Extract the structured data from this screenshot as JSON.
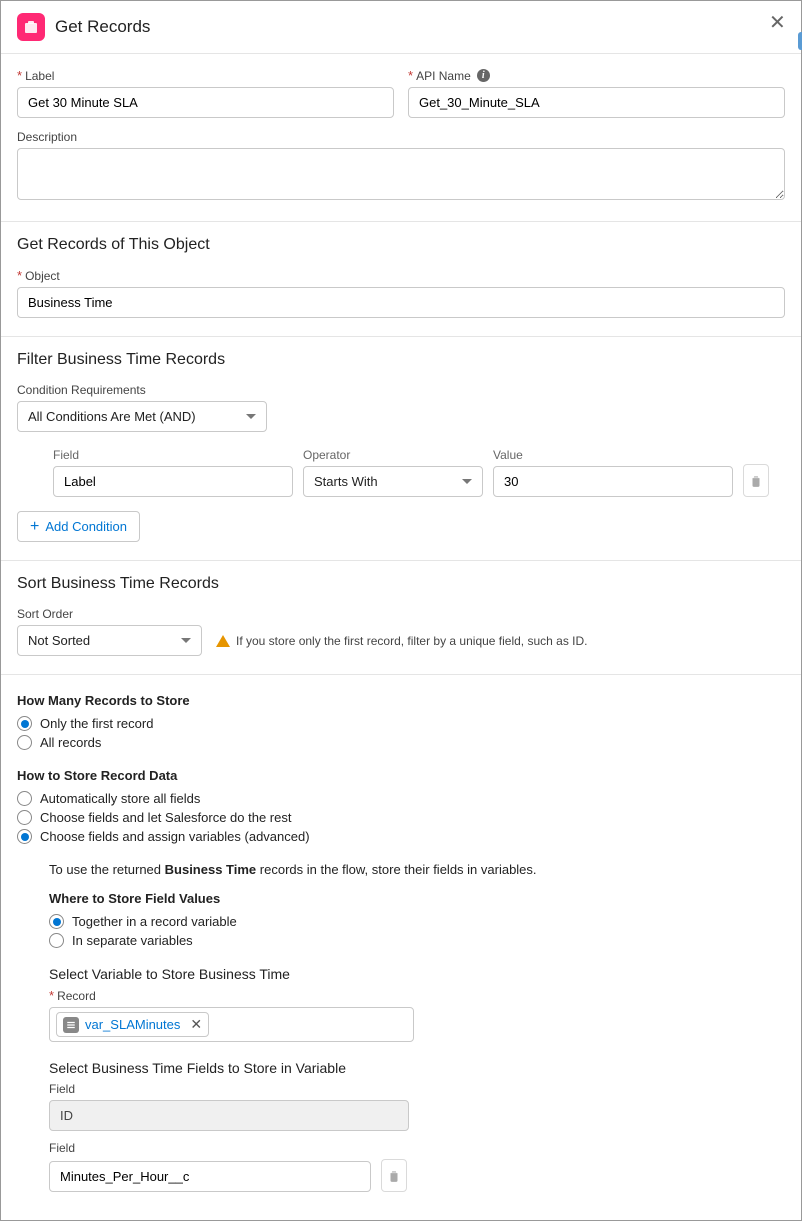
{
  "header": {
    "title": "Get Records"
  },
  "labels": {
    "label_field": "Label",
    "api_name": "API Name",
    "description": "Description",
    "object": "Object",
    "condition_req": "Condition Requirements",
    "field": "Field",
    "operator": "Operator",
    "value": "Value",
    "add_condition": "Add Condition",
    "sort_order": "Sort Order",
    "record": "Record"
  },
  "section_titles": {
    "get_object": "Get Records of This Object",
    "filter": "Filter Business Time Records",
    "sort": "Sort Business Time Records"
  },
  "values": {
    "label_value": "Get 30 Minute SLA",
    "api_name_value": "Get_30_Minute_SLA",
    "object_value": "Business Time",
    "condition_value": "All Conditions Are Met (AND)",
    "filter_field": "Label",
    "filter_operator": "Starts With",
    "filter_value": "30",
    "sort_value": "Not Sorted",
    "variable_pill": "var_SLAMinutes",
    "field_id": "ID",
    "field_minutes": "Minutes_Per_Hour__c"
  },
  "messages": {
    "sort_warn": "If you store only the first record, filter by a unique field, such as ID.",
    "use_returned_prefix": "To use the returned ",
    "use_returned_bold": "Business Time",
    "use_returned_suffix": " records in the flow, store their fields in variables."
  },
  "store": {
    "how_many_title": "How Many Records to Store",
    "opt_first": "Only the first record",
    "opt_all": "All records",
    "how_store_title": "How to Store Record Data",
    "opt_auto": "Automatically store all fields",
    "opt_choose_sf": "Choose fields and let Salesforce do the rest",
    "opt_choose_adv": "Choose fields and assign variables (advanced)",
    "where_title": "Where to Store Field Values",
    "opt_together": "Together in a record variable",
    "opt_separate": "In separate variables",
    "select_var_title": "Select Variable to Store Business Time",
    "select_fields_title": "Select Business Time Fields to Store in Variable"
  }
}
